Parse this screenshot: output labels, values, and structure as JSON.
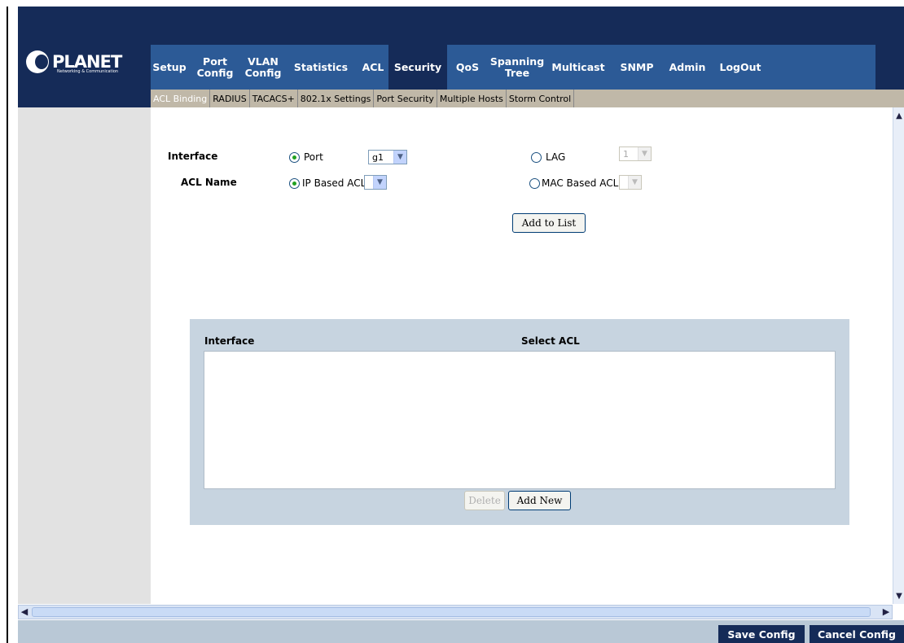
{
  "brand": {
    "name": "PLANET",
    "tagline": "Networking & Communication"
  },
  "nav": [
    {
      "label": "Setup",
      "w": 46
    },
    {
      "label": "Port\nConfig",
      "w": 66
    },
    {
      "label": "VLAN\nConfig",
      "w": 52
    },
    {
      "label": "Statistics",
      "w": 90
    },
    {
      "label": "ACL",
      "w": 38
    },
    {
      "label": "Security",
      "w": 72
    },
    {
      "label": "QoS",
      "w": 50
    },
    {
      "label": "Spanning\nTree",
      "w": 72
    },
    {
      "label": "Multicast",
      "w": 78
    },
    {
      "label": "SNMP",
      "w": 66
    },
    {
      "label": "Admin",
      "w": 58
    },
    {
      "label": "LogOut",
      "w": 72
    }
  ],
  "active_nav": "Security",
  "subnav": [
    "ACL Binding",
    "RADIUS",
    "TACACS+",
    "802.1x Settings",
    "Port Security",
    "Multiple Hosts",
    "Storm Control"
  ],
  "active_subnav": "ACL Binding",
  "form": {
    "interface_label": "Interface",
    "acl_name_label": "ACL Name",
    "port_radio_label": "Port",
    "port_value": "g1",
    "lag_radio_label": "LAG",
    "lag_value": "1",
    "ip_acl_label": "IP Based ACL",
    "ip_acl_value": "",
    "mac_acl_label": "MAC Based ACL",
    "mac_acl_value": "",
    "add_to_list": "Add to List"
  },
  "table": {
    "col_interface": "Interface",
    "col_select_acl": "Select ACL",
    "delete_label": "Delete",
    "add_new_label": "Add New"
  },
  "footer": {
    "save": "Save Config",
    "cancel": "Cancel Config"
  },
  "colors": {
    "banner": "#152b58",
    "navbar": "#2c5a96",
    "subnav": "#c0b8a8",
    "panel": "#c7d4e0"
  }
}
